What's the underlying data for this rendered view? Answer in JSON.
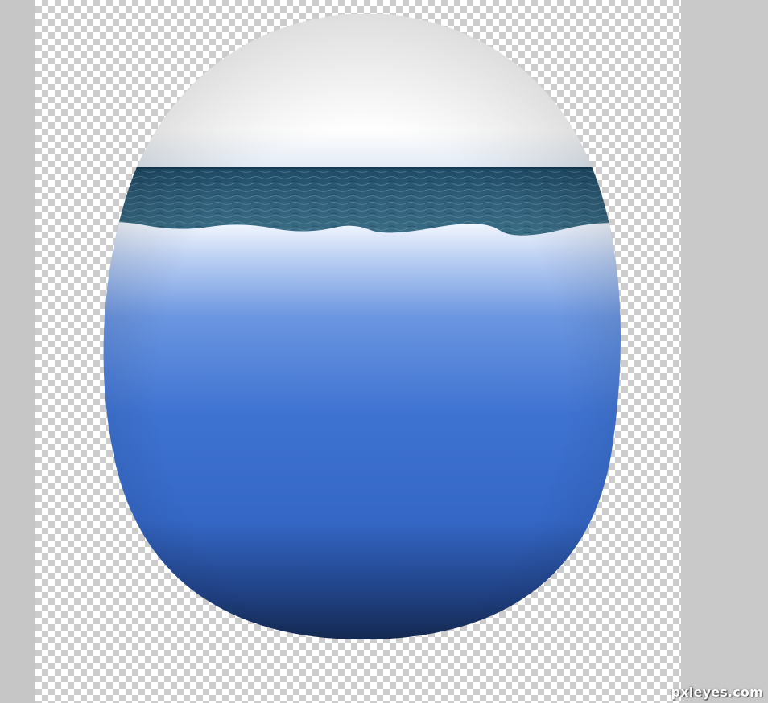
{
  "watermark": {
    "text": "pxleyes.com"
  },
  "colors": {
    "canvas_check_light": "#ffffff",
    "canvas_check_dark": "#cccccc",
    "workspace_gray": "#c6c6c6",
    "sky": "#ffffff",
    "sea_surface": "#2f5a73",
    "water_top": "#e8efff",
    "water_mid": "#3a6fd0",
    "water_bottom": "#0a1428"
  },
  "artwork": {
    "subject": "egg-shape",
    "layers": [
      "sky-layer",
      "sea-surface-layer",
      "underwater-gradient-layer"
    ]
  }
}
